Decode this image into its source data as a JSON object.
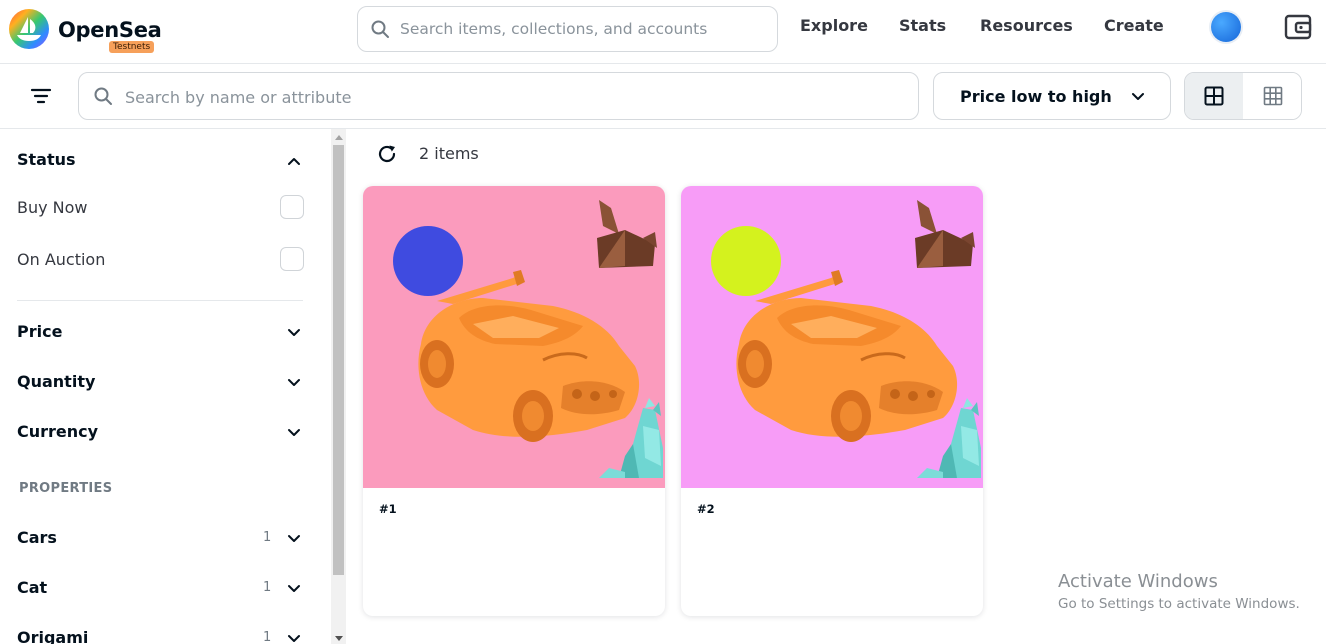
{
  "brand": {
    "name": "OpenSea",
    "badge": "Testnets"
  },
  "header": {
    "search_placeholder": "Search items, collections, and accounts",
    "nav": [
      "Explore",
      "Stats",
      "Resources",
      "Create"
    ]
  },
  "toolbar": {
    "item_search_placeholder": "Search by name or attribute",
    "sort_label": "Price low to high"
  },
  "sidebar": {
    "status": {
      "title": "Status",
      "options": [
        {
          "label": "Buy Now",
          "checked": false
        },
        {
          "label": "On Auction",
          "checked": false
        }
      ]
    },
    "filters": [
      "Price",
      "Quantity",
      "Currency"
    ],
    "properties_title": "PROPERTIES",
    "properties": [
      {
        "label": "Cars",
        "count": "1"
      },
      {
        "label": "Cat",
        "count": "1"
      },
      {
        "label": "Origami",
        "count": "1"
      }
    ]
  },
  "results": {
    "count_label": "2 items",
    "items": [
      {
        "name": "#1",
        "background": "#fb9bbd",
        "ball": "#3f4be0"
      },
      {
        "name": "#2",
        "background": "#f79cf7",
        "ball": "#d4f21e"
      }
    ]
  },
  "watermark": {
    "title": "Activate Windows",
    "subtitle": "Go to Settings to activate Windows."
  }
}
